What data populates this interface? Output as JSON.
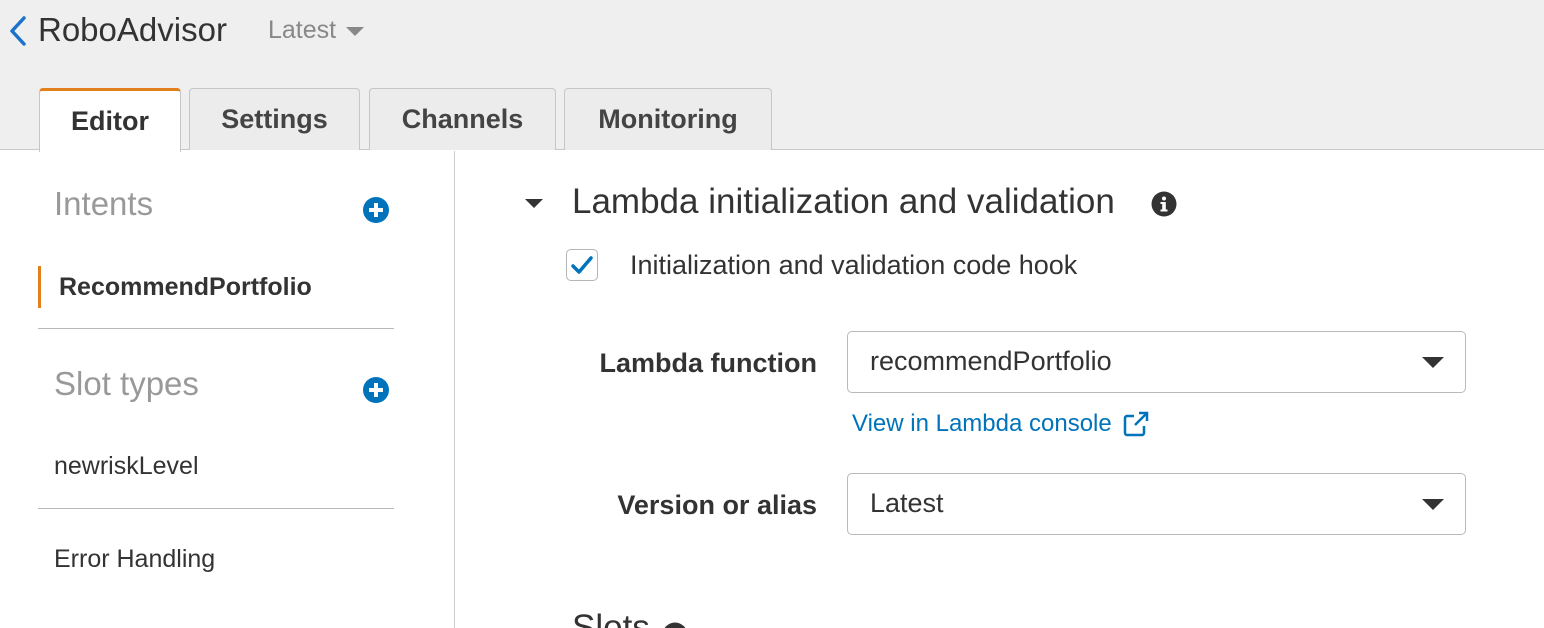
{
  "header": {
    "bot_name": "RoboAdvisor",
    "version": "Latest"
  },
  "tabs": [
    {
      "label": "Editor",
      "active": true
    },
    {
      "label": "Settings",
      "active": false
    },
    {
      "label": "Channels",
      "active": false
    },
    {
      "label": "Monitoring",
      "active": false
    }
  ],
  "sidebar": {
    "intents_title": "Intents",
    "intents": [
      "RecommendPortfolio"
    ],
    "slot_types_title": "Slot types",
    "slot_types": [
      "newriskLevel"
    ],
    "error_handling": "Error Handling"
  },
  "main": {
    "section_title": "Lambda initialization and validation",
    "checkbox_label": "Initialization and validation code hook",
    "checkbox_checked": true,
    "lambda_function_label": "Lambda function",
    "lambda_function_value": "recommendPortfolio",
    "console_link": "View in Lambda console",
    "version_label": "Version or alias",
    "version_value": "Latest",
    "next_section_partial": "Slots"
  },
  "colors": {
    "accent": "#e2801d",
    "link": "#0073bb",
    "add_icon": "#0073bb",
    "checkbox_check": "#0073bb"
  }
}
